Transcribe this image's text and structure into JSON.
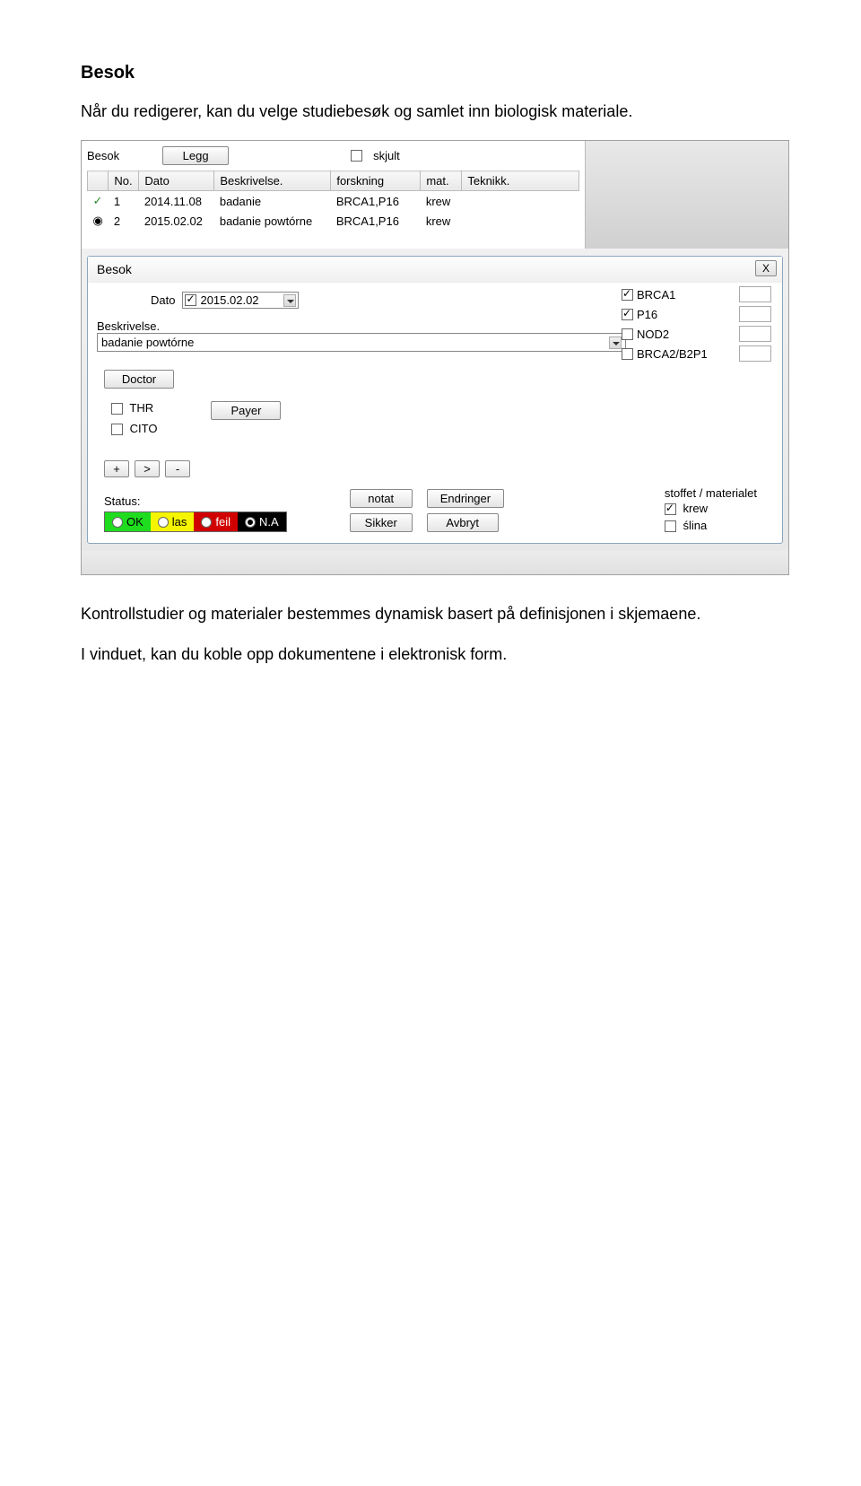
{
  "doc": {
    "heading": "Besok",
    "intro": "Når du redigerer, kan du velge studiebesøk og samlet inn biologisk materiale.",
    "after1": "Kontrollstudier og materialer bestemmes dynamisk basert på definisjonen i skjemaene.",
    "after2": "I vinduet, kan du koble opp dokumentene i elektronisk form."
  },
  "toolbar": {
    "besok_label": "Besok",
    "legg_label": "Legg",
    "skjult_label": "skjult"
  },
  "columns": {
    "no": "No.",
    "dato": "Dato",
    "beskrivelse": "Beskrivelse.",
    "forskning": "forskning",
    "mat": "mat.",
    "teknikk": "Teknikk."
  },
  "rows": [
    {
      "icon": "✓",
      "no": "1",
      "dato": "2014.11.08",
      "besk": "badanie",
      "forsk": "BRCA1,P16",
      "mat": "krew"
    },
    {
      "icon": "◉",
      "no": "2",
      "dato": "2015.02.02",
      "besk": "badanie powtórne",
      "forsk": "BRCA1,P16",
      "mat": "krew"
    }
  ],
  "dialog": {
    "title": "Besok",
    "close": "X",
    "dato_label": "Dato",
    "dato_value": "2015.02.02",
    "besk_label": "Beskrivelse.",
    "besk_value": "badanie powtórne",
    "doctor_btn": "Doctor",
    "payer_btn": "Payer",
    "thr_label": "THR",
    "cito_label": "CITO",
    "plus": "+",
    "gt": ">",
    "minus": "-",
    "status_label": "Status:",
    "s_ok": "OK",
    "s_las": "las",
    "s_feil": "feil",
    "s_na": "N.A",
    "notat_btn": "notat",
    "endringer_btn": "Endringer",
    "sikker_btn": "Sikker",
    "avbryt_btn": "Avbryt",
    "material_label": "stoffet / materialet",
    "mat_krew": "krew",
    "mat_slina": "ślina",
    "g_brca1": "BRCA1",
    "g_p16": "P16",
    "g_nod2": "NOD2",
    "g_brca2": "BRCA2/B2P1"
  }
}
